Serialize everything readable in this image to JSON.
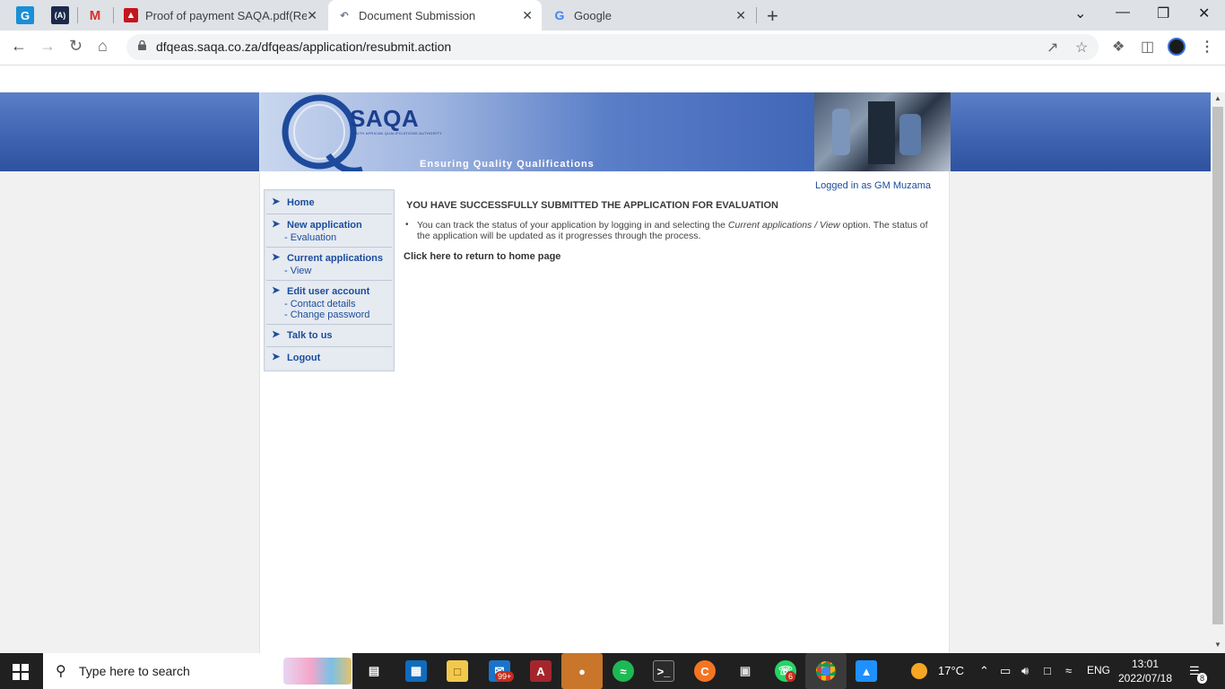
{
  "browser": {
    "tabs": [
      {
        "title": "Proof of payment SAQA.pdf(Revi",
        "icon": "pdf-icon"
      },
      {
        "title": "Document Submission",
        "icon": "saqa-tab-icon",
        "active": true
      },
      {
        "title": "Google",
        "icon": "google-icon"
      }
    ],
    "pinned": [
      "G",
      "(A)",
      "M"
    ],
    "url": "dfqeas.saqa.co.za/dfqeas/application/resubmit.action"
  },
  "header": {
    "logo": "SAQA",
    "logo_sub": "SOUTH AFRICAN QUALIFICATIONS AUTHORITY",
    "tagline": "Ensuring Quality Qualifications",
    "logged_in": "Logged in as GM Muzama"
  },
  "menu": [
    {
      "label": "Home",
      "subs": []
    },
    {
      "label": "New application",
      "subs": [
        "- Evaluation"
      ]
    },
    {
      "label": "Current applications",
      "subs": [
        "- View"
      ]
    },
    {
      "label": "Edit user account",
      "subs": [
        "- Contact details",
        "- Change password"
      ]
    },
    {
      "label": "Talk to us",
      "subs": []
    },
    {
      "label": "Logout",
      "subs": []
    }
  ],
  "message": {
    "title": "YOU HAVE SUCCESSFULLY SUBMITTED THE APPLICATION FOR EVALUATION",
    "body_pre": "You can track the status of your application by logging in and selecting the ",
    "body_em": "Current applications / View",
    "body_post": " option. The status of the application will be updated as it progresses through the process.",
    "home_link": "Click here to return to home page"
  },
  "taskbar": {
    "search_placeholder": "Type here to search",
    "mail_badge": "99+",
    "whatsapp_badge": "6",
    "weather": "17°C",
    "lang": "ENG",
    "time": "13:01",
    "date": "2022/07/18",
    "notifications": "8"
  },
  "colors": {
    "link": "#1a4d9c",
    "banner": "#3d62b0"
  }
}
